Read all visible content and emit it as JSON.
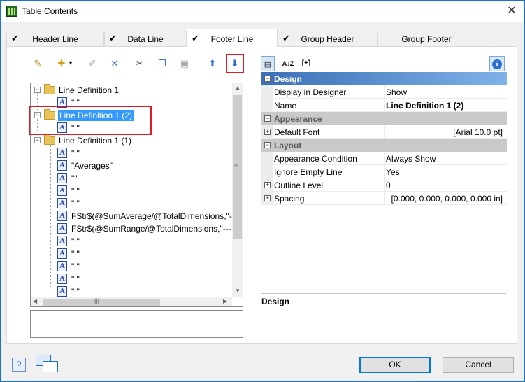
{
  "window": {
    "title": "Table Contents",
    "close_glyph": "✕"
  },
  "tabs": [
    {
      "label": "Header Line",
      "checked": true
    },
    {
      "label": "Data Line",
      "checked": true
    },
    {
      "label": "Footer Line",
      "checked": true,
      "active": true
    },
    {
      "label": "Group Header",
      "checked": true
    },
    {
      "label": "Group Footer",
      "checked": false
    }
  ],
  "toolbar": {
    "buttons": [
      {
        "name": "wizard-icon",
        "glyph": "✎"
      },
      {
        "name": "new-icon",
        "glyph": "✚"
      },
      {
        "name": "dropdown-arrow-icon",
        "glyph": "▾"
      },
      {
        "name": "edit-icon",
        "glyph": "✐"
      },
      {
        "name": "delete-icon",
        "glyph": "✕"
      },
      {
        "name": "cut-icon",
        "glyph": "✂"
      },
      {
        "name": "copy-icon",
        "glyph": "❐"
      },
      {
        "name": "paste-icon",
        "glyph": "▣"
      },
      {
        "name": "move-up-icon",
        "glyph": "⬆"
      },
      {
        "name": "move-down-icon",
        "glyph": "⬇"
      }
    ]
  },
  "tree": {
    "items": [
      {
        "kind": "folder",
        "text": "Line Definition  1"
      },
      {
        "kind": "field",
        "text": "\" \""
      },
      {
        "kind": "folder",
        "text": "Line Definition  1 (2)",
        "selected": true
      },
      {
        "kind": "field",
        "text": "\" \""
      },
      {
        "kind": "folder",
        "text": "Line Definition  1 (1)"
      },
      {
        "kind": "field",
        "text": "\" \""
      },
      {
        "kind": "field",
        "text": "\"Averages\""
      },
      {
        "kind": "field",
        "text": "\"\""
      },
      {
        "kind": "field",
        "text": "\" \""
      },
      {
        "kind": "field",
        "text": "\" \""
      },
      {
        "kind": "field",
        "text": "FStr$(@SumAverage/@TotalDimensions,\"-"
      },
      {
        "kind": "field",
        "text": "FStr$(@SumRange/@TotalDimensions,\"---"
      },
      {
        "kind": "field",
        "text": "\" \""
      },
      {
        "kind": "field",
        "text": "\" \""
      },
      {
        "kind": "field",
        "text": "\" \""
      },
      {
        "kind": "field",
        "text": "\" \""
      },
      {
        "kind": "field",
        "text": "\" \""
      }
    ],
    "scroll_grip": "≡",
    "hscroll_grip": "|||"
  },
  "property_toolbar": {
    "categorized_glyph": "▤",
    "sort_glyph": "A↓Z",
    "expand_glyph": "[+]",
    "info_glyph": "i"
  },
  "properties": {
    "categories": [
      {
        "label": "Design",
        "rows": [
          {
            "name": "Display in Designer",
            "value": "Show"
          },
          {
            "name": "Name",
            "value": "Line Definition  1 (2)"
          }
        ]
      },
      {
        "label": "Appearance",
        "rows": [
          {
            "name": "Default Font",
            "value": "[Arial 10.0 pt]"
          }
        ]
      },
      {
        "label": "Layout",
        "rows": [
          {
            "name": "Appearance Condition",
            "value": "Always Show"
          },
          {
            "name": "Ignore Empty Line",
            "value": "Yes"
          },
          {
            "name": "Outline Level",
            "value": "0"
          },
          {
            "name": "Spacing",
            "value": "[0.000, 0.000, 0.000, 0.000 in]"
          }
        ]
      }
    ],
    "description_title": "Design"
  },
  "footer": {
    "help_glyph": "?",
    "ok_label": "OK",
    "cancel_label": "Cancel"
  }
}
